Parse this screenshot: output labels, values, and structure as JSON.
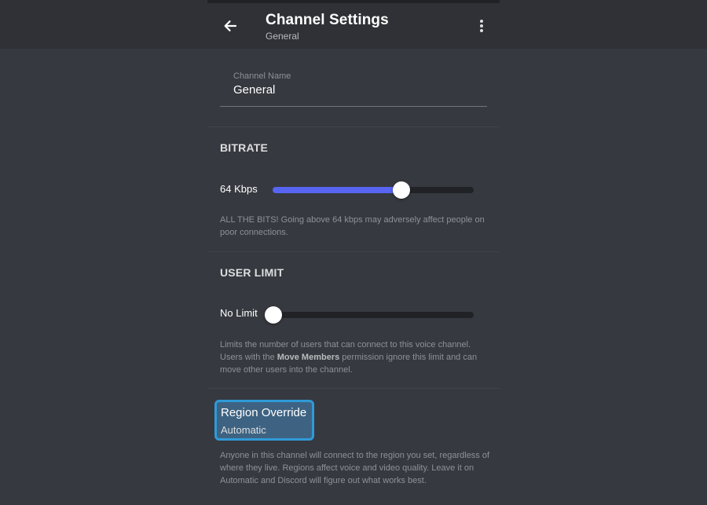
{
  "header": {
    "title": "Channel Settings",
    "subtitle": "General",
    "back_icon": "arrow-left-icon",
    "menu_icon": "more-vertical-icon"
  },
  "channel_name": {
    "label": "Channel Name",
    "value": "General"
  },
  "bitrate": {
    "title": "BITRATE",
    "value_label": "64 Kbps",
    "level": 0.64,
    "help": "ALL THE BITS! Going above 64 kbps may adversely affect people on poor connections."
  },
  "user_limit": {
    "title": "USER LIMIT",
    "value_label": "No Limit",
    "level": 0,
    "help_before": "Limits the number of users that can connect to this voice channel. Users with the ",
    "help_bold": "Move Members",
    "help_after": " permission ignore this limit and can move other users into the channel."
  },
  "region": {
    "title": "Region Override",
    "value": "Automatic",
    "help": "Anyone in this channel will connect to the region you set, regardless of where they live. Regions affect voice and video quality. Leave it on Automatic and Discord will figure out what works best."
  },
  "colors": {
    "background": "#36393f",
    "header": "#2f3136",
    "accent": "#5865f2",
    "focus_ring": "#2f9ad8"
  }
}
